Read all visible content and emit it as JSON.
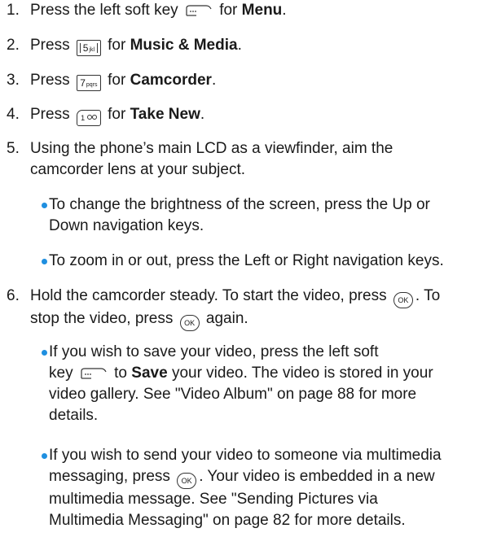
{
  "steps": [
    {
      "num": "1.",
      "pre": "Press the left soft key",
      "mid": "for",
      "bold": "Menu",
      "post": "."
    },
    {
      "num": "2.",
      "pre": "Press",
      "key_num": "5",
      "key_sub": "jkl",
      "mid": "for",
      "bold": "Music & Media",
      "post": "."
    },
    {
      "num": "3.",
      "pre": "Press",
      "key_num": "7",
      "key_sub": "pqrs",
      "mid": "for",
      "bold": "Camcorder",
      "post": "."
    },
    {
      "num": "4.",
      "pre": "Press",
      "key_num": "1",
      "key_sub": "",
      "mid": "for",
      "bold": "Take New",
      "post": "."
    },
    {
      "num": "5.",
      "line1": "Using the phone’s main LCD as a viewfinder, aim the",
      "line2": "camcorder lens at your subject."
    },
    {
      "num": "6.",
      "line1a": "Hold the camcorder steady. To start the video, press",
      "line1b": ". To",
      "line2a": "stop the video, press",
      "line2b": "again."
    }
  ],
  "bullets5": [
    {
      "line1": "To change the brightness of the screen, press the Up or",
      "line2": "Down navigation keys."
    },
    {
      "line1": "To zoom in or out, press the Left or Right navigation keys."
    }
  ],
  "bullets6": [
    {
      "line1": "If you wish to save your video, press the left soft",
      "line2a": "key",
      "line2b": "to",
      "line2bold": "Save",
      "line2c": "your video. The video is stored in your",
      "line3": "video gallery. See \"Video Album\" on page 88 for more",
      "line4": "details."
    },
    {
      "line1": "If you wish to send your video to someone via multimedia",
      "line2a": "messaging, press",
      "line2b": ". Your video is embedded in a new",
      "line3": "multimedia message. See \"Sending Pictures via",
      "line4": "Multimedia Messaging\" on page 82 for more details."
    }
  ],
  "icons": {
    "ok_label": "OK",
    "soft_key": "left-soft-key-icon"
  },
  "colors": {
    "bullet": "#1f8fe0",
    "text": "#1a1a1a"
  }
}
